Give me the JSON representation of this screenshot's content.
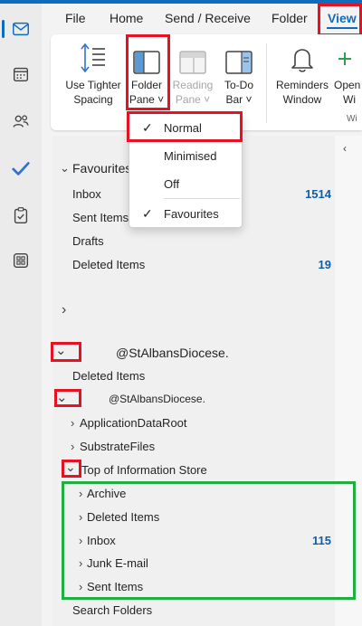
{
  "ribbon_tabs": [
    "File",
    "Home",
    "Send / Receive",
    "Folder",
    "View"
  ],
  "ribbon": {
    "tighter_spacing": [
      "Use Tighter",
      "Spacing"
    ],
    "folder_pane": [
      "Folder",
      "Pane ˅"
    ],
    "reading_pane": [
      "Reading",
      "Pane ˅"
    ],
    "todo_bar": [
      "To-Do",
      "Bar ˅"
    ],
    "reminders": [
      "Reminders",
      "Window"
    ],
    "open": [
      "Open",
      "Wi"
    ],
    "group_label": "Wi"
  },
  "dropdown": {
    "items": [
      {
        "label": "Normal",
        "checked": true
      },
      {
        "label": "Minimised",
        "checked": false
      },
      {
        "label": "Off",
        "checked": false
      },
      {
        "label": "Favourites",
        "checked": true
      }
    ]
  },
  "favourites": {
    "header": "Favourites",
    "items": [
      {
        "label": "Inbox",
        "count": "1514"
      },
      {
        "label": "Sent Items",
        "count": ""
      },
      {
        "label": "Drafts",
        "count": ""
      },
      {
        "label": "Deleted Items",
        "count": "19"
      }
    ]
  },
  "account1": {
    "name": "@StAlbansDiocese.",
    "deleted_items": "Deleted Items"
  },
  "account2": {
    "name": "@StAlbansDiocese.",
    "folders": [
      "ApplicationDataRoot",
      "SubstrateFiles",
      "Top of Information Store"
    ]
  },
  "store_folders": [
    {
      "label": "Archive",
      "count": ""
    },
    {
      "label": "Deleted Items",
      "count": ""
    },
    {
      "label": "Inbox",
      "count": "115"
    },
    {
      "label": "Junk E-mail",
      "count": ""
    },
    {
      "label": "Sent Items",
      "count": ""
    }
  ],
  "search_folders": "Search Folders",
  "colors": {
    "accent": "#0f6cbd",
    "highlight_red": "#e81123",
    "highlight_green": "#1fae3f",
    "count_blue": "#0f5fa8"
  },
  "rail_icons": [
    "mail-icon",
    "calendar-icon",
    "people-icon",
    "todo-icon",
    "tasks-icon",
    "apps-icon"
  ]
}
